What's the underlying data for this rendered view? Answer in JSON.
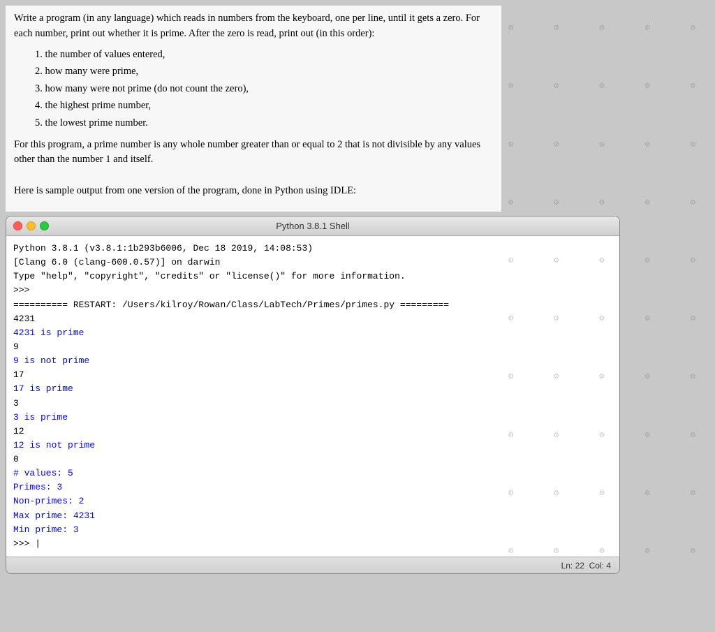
{
  "page": {
    "background_color": "#c8c8c8"
  },
  "problem": {
    "intro": "Write a program (in any language) which reads in numbers from the keyboard, one per line, until it gets a zero. For each number, print out whether it is prime. After the zero is read, print out (in this order):",
    "list": [
      "1. the number of values entered,",
      "2. how many were prime,",
      "3. how many were not prime (do not count the zero),",
      "4. the highest prime number,",
      "5. the lowest prime number."
    ],
    "prime_def": "For this program, a prime number is any whole number greater than or equal to 2 that is not divisible by any values other than the number 1 and itself.",
    "sample_intro": "Here is sample output from one version of the program, done in Python using IDLE:"
  },
  "shell": {
    "title": "Python 3.8.1 Shell",
    "titlebar_label": "Python 3.8.1 Shell",
    "header_line1": "Python 3.8.1 (v3.8.1:1b293b6006, Dec 18 2019, 14:08:53)",
    "header_line2": "[Clang 6.0 (clang-600.0.57)] on darwin",
    "header_line3": "Type \"help\", \"copyright\", \"credits\" or \"license()\" for more information.",
    "prompt1": ">>>",
    "restart_line": "========== RESTART: /Users/kilroy/Rowan/Class/LabTech/Primes/primes.py =========",
    "output_lines": [
      {
        "text": "4231",
        "color": "black"
      },
      {
        "text": "4231 is prime",
        "color": "blue"
      },
      {
        "text": "9",
        "color": "black"
      },
      {
        "text": "9 is not prime",
        "color": "blue"
      },
      {
        "text": "17",
        "color": "black"
      },
      {
        "text": "17 is prime",
        "color": "blue"
      },
      {
        "text": "3",
        "color": "black"
      },
      {
        "text": "3 is prime",
        "color": "blue"
      },
      {
        "text": "12",
        "color": "black"
      },
      {
        "text": "12 is not prime",
        "color": "blue"
      },
      {
        "text": "0",
        "color": "black"
      },
      {
        "text": "  # values: 5",
        "color": "blue"
      },
      {
        "text": "    Primes: 3",
        "color": "blue"
      },
      {
        "text": "Non-primes: 2",
        "color": "blue"
      },
      {
        "text": " Max prime: 4231",
        "color": "blue"
      },
      {
        "text": " Min prime: 3",
        "color": "blue"
      }
    ],
    "final_prompt": ">>> |",
    "statusbar": {
      "ln_label": "Ln:",
      "ln_value": "22",
      "col_label": "Col:",
      "col_value": "4"
    }
  }
}
